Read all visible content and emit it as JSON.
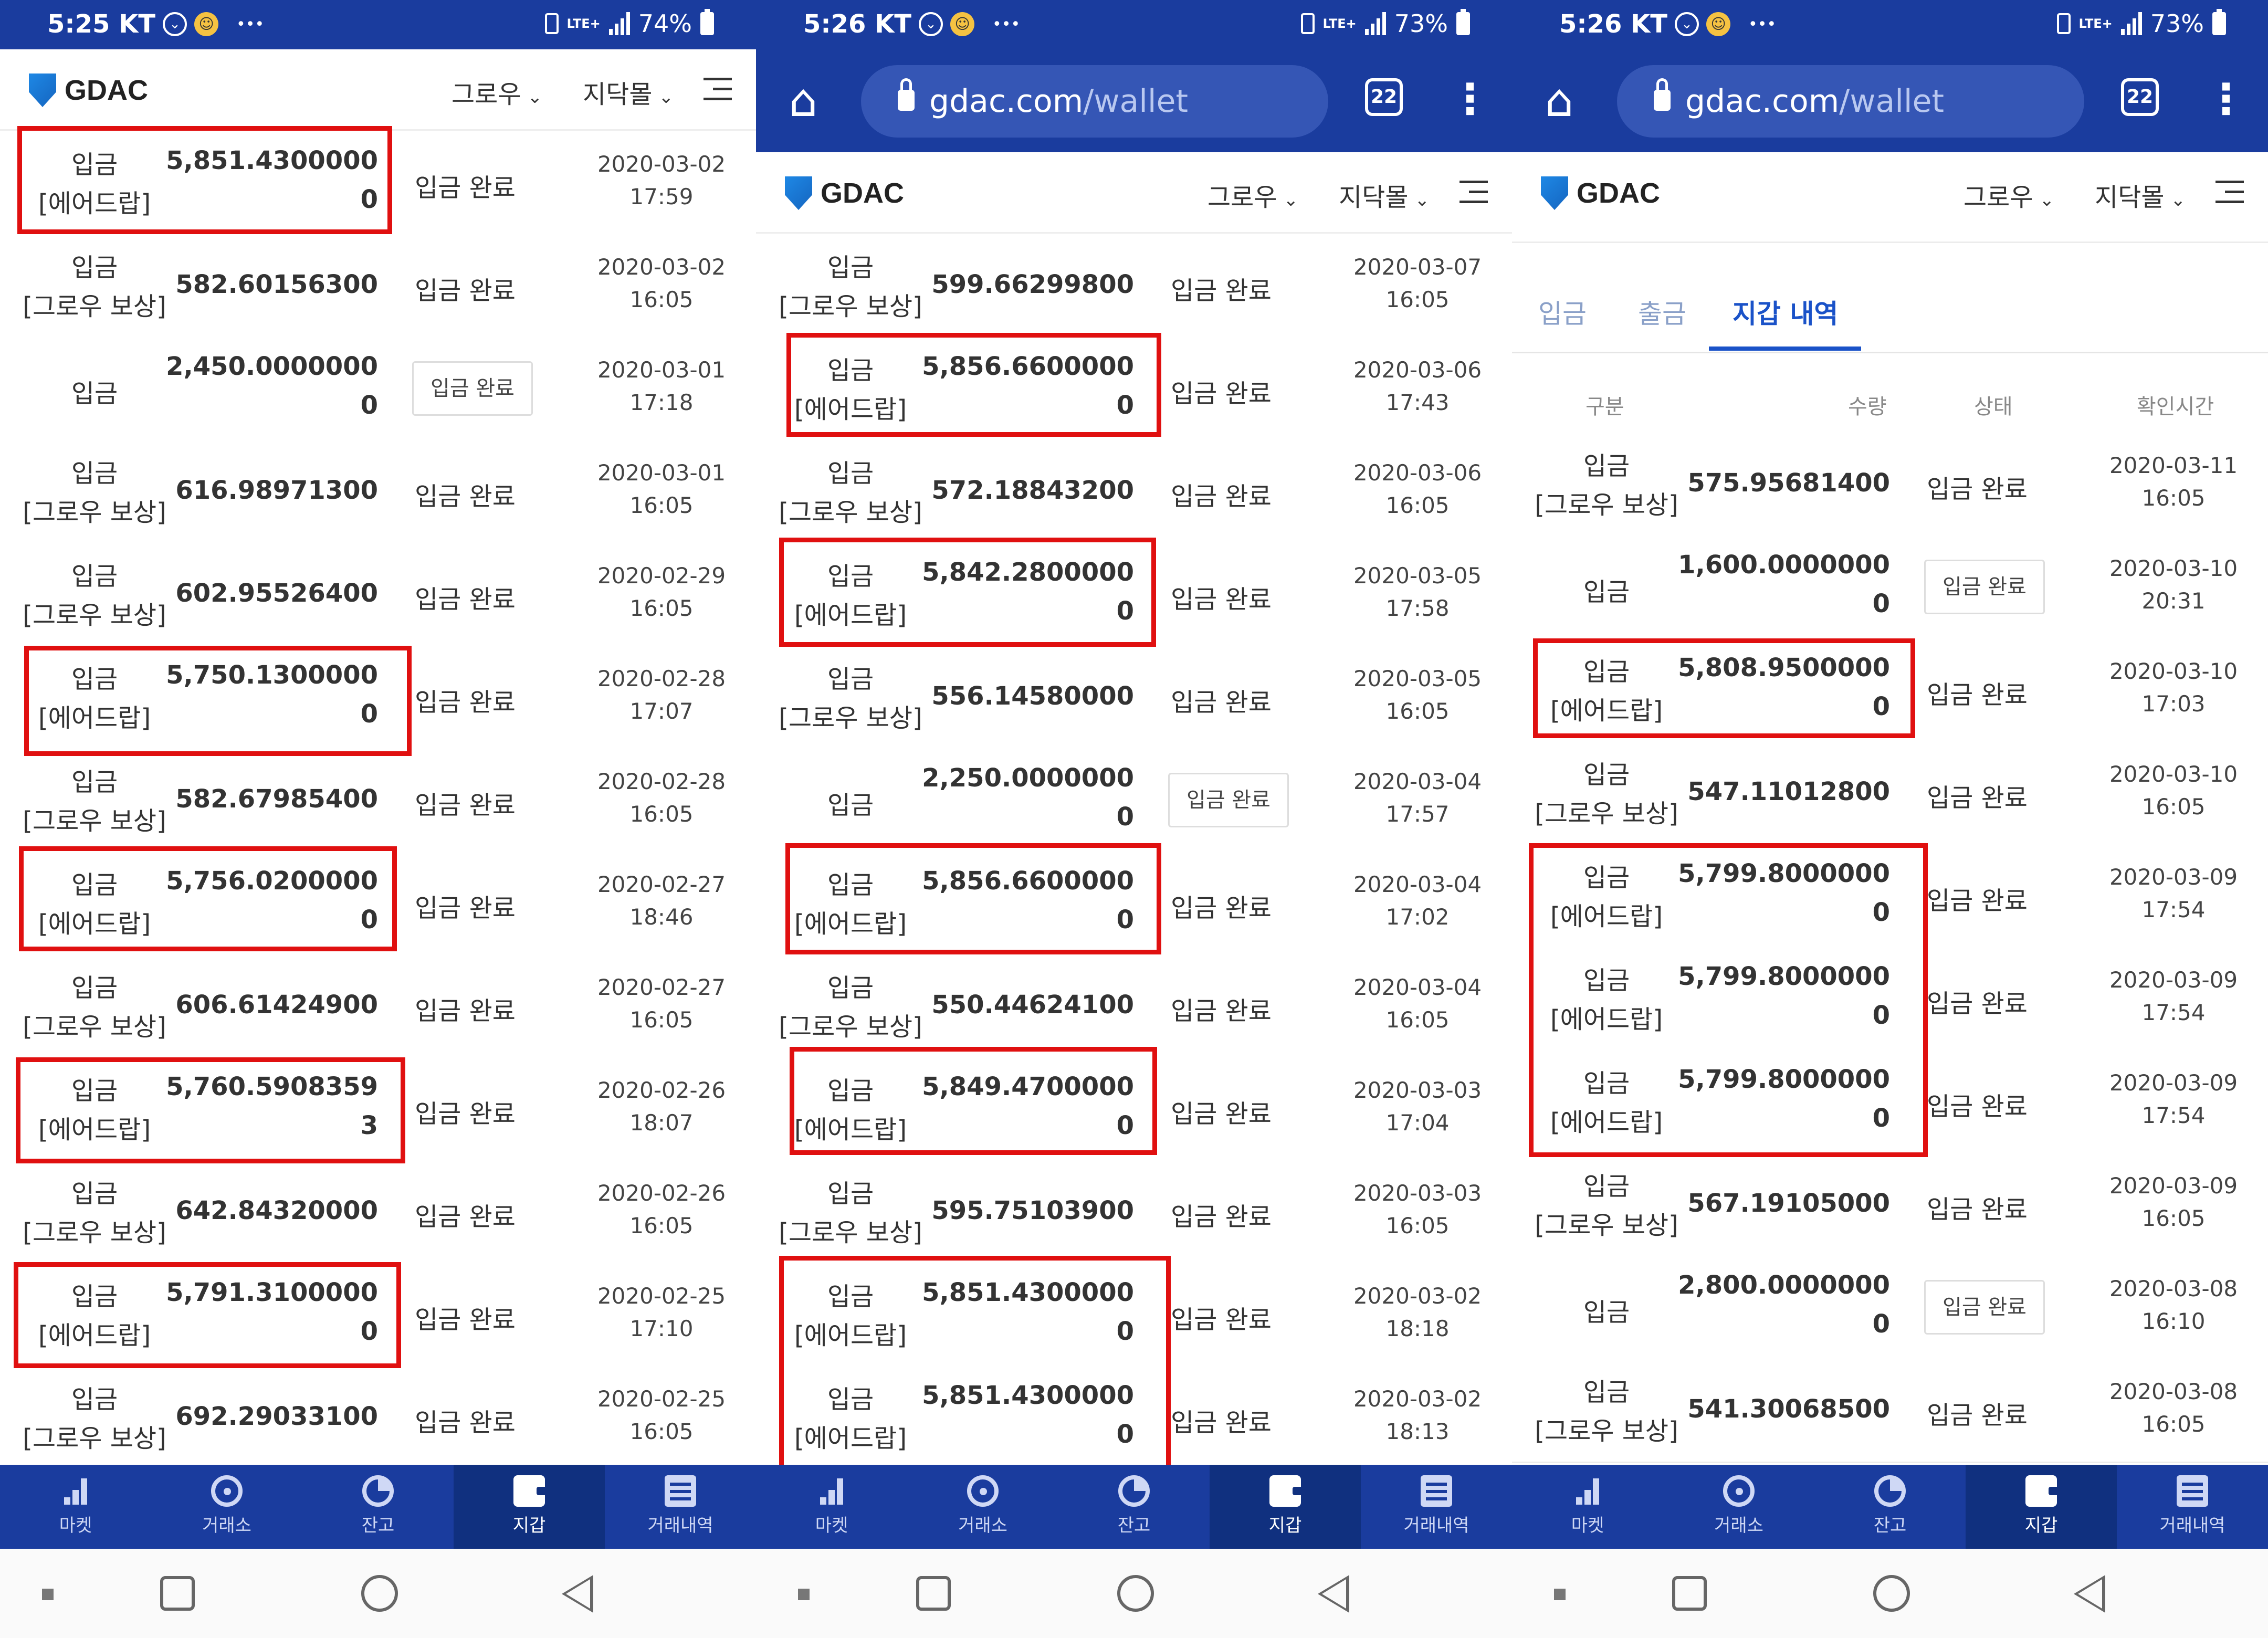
{
  "panels": [
    {
      "status": {
        "time": "5:25 KT",
        "battery": "74%",
        "network": "LTE+"
      },
      "header": {
        "logo": "GDAC",
        "menu1": "그로우",
        "menu2": "지닥몰"
      },
      "rows": [
        {
          "type1": "입금",
          "type2": "[에어드랍]",
          "amt1": "5,851.4300000",
          "amt2": "0",
          "state": "입금 완료",
          "date": "2020-03-02",
          "time": "17:59"
        },
        {
          "type1": "입금",
          "type2": "[그로우 보상]",
          "amt1": "582.60156300",
          "amt2": "",
          "state": "입금 완료",
          "date": "2020-03-02",
          "time": "16:05"
        },
        {
          "type1": "입금",
          "type2": "",
          "amt1": "2,450.0000000",
          "amt2": "0",
          "state": "입금 완료",
          "date": "2020-03-01",
          "time": "17:18"
        },
        {
          "type1": "입금",
          "type2": "[그로우 보상]",
          "amt1": "616.98971300",
          "amt2": "",
          "state": "입금 완료",
          "date": "2020-03-01",
          "time": "16:05"
        },
        {
          "type1": "입금",
          "type2": "[그로우 보상]",
          "amt1": "602.95526400",
          "amt2": "",
          "state": "입금 완료",
          "date": "2020-02-29",
          "time": "16:05"
        },
        {
          "type1": "입금",
          "type2": "[에어드랍]",
          "amt1": "5,750.1300000",
          "amt2": "0",
          "state": "입금 완료",
          "date": "2020-02-28",
          "time": "17:07"
        },
        {
          "type1": "입금",
          "type2": "[그로우 보상]",
          "amt1": "582.67985400",
          "amt2": "",
          "state": "입금 완료",
          "date": "2020-02-28",
          "time": "16:05"
        },
        {
          "type1": "입금",
          "type2": "[에어드랍]",
          "amt1": "5,756.0200000",
          "amt2": "0",
          "state": "입금 완료",
          "date": "2020-02-27",
          "time": "18:46"
        },
        {
          "type1": "입금",
          "type2": "[그로우 보상]",
          "amt1": "606.61424900",
          "amt2": "",
          "state": "입금 완료",
          "date": "2020-02-27",
          "time": "16:05"
        },
        {
          "type1": "입금",
          "type2": "[에어드랍]",
          "amt1": "5,760.5908359",
          "amt2": "3",
          "state": "입금 완료",
          "date": "2020-02-26",
          "time": "18:07"
        },
        {
          "type1": "입금",
          "type2": "[그로우 보상]",
          "amt1": "642.84320000",
          "amt2": "",
          "state": "입금 완료",
          "date": "2020-02-26",
          "time": "16:05"
        },
        {
          "type1": "입금",
          "type2": "[에어드랍]",
          "amt1": "5,791.3100000",
          "amt2": "0",
          "state": "입금 완료",
          "date": "2020-02-25",
          "time": "17:10"
        },
        {
          "type1": "입금",
          "type2": "[그로우 보상]",
          "amt1": "692.29033100",
          "amt2": "",
          "state": "입금 완료",
          "date": "2020-02-25",
          "time": "16:05"
        }
      ],
      "nav": [
        "마켓",
        "거래소",
        "잔고",
        "지갑",
        "거래내역"
      ]
    },
    {
      "status": {
        "time": "5:26 KT",
        "battery": "73%",
        "network": "LTE+"
      },
      "url": {
        "domain": "gdac.com",
        "path": "/wallet",
        "tabs": "22"
      },
      "header": {
        "logo": "GDAC",
        "menu1": "그로우",
        "menu2": "지닥몰"
      },
      "rows": [
        {
          "type1": "입금",
          "type2": "[그로우 보상]",
          "amt1": "599.66299800",
          "amt2": "",
          "state": "입금 완료",
          "date": "2020-03-07",
          "time": "16:05"
        },
        {
          "type1": "입금",
          "type2": "[에어드랍]",
          "amt1": "5,856.6600000",
          "amt2": "0",
          "state": "입금 완료",
          "date": "2020-03-06",
          "time": "17:43"
        },
        {
          "type1": "입금",
          "type2": "[그로우 보상]",
          "amt1": "572.18843200",
          "amt2": "",
          "state": "입금 완료",
          "date": "2020-03-06",
          "time": "16:05"
        },
        {
          "type1": "입금",
          "type2": "[에어드랍]",
          "amt1": "5,842.2800000",
          "amt2": "0",
          "state": "입금 완료",
          "date": "2020-03-05",
          "time": "17:58"
        },
        {
          "type1": "입금",
          "type2": "[그로우 보상]",
          "amt1": "556.14580000",
          "amt2": "",
          "state": "입금 완료",
          "date": "2020-03-05",
          "time": "16:05"
        },
        {
          "type1": "입금",
          "type2": "",
          "amt1": "2,250.0000000",
          "amt2": "0",
          "state": "입금 완료",
          "date": "2020-03-04",
          "time": "17:57"
        },
        {
          "type1": "입금",
          "type2": "[에어드랍]",
          "amt1": "5,856.6600000",
          "amt2": "0",
          "state": "입금 완료",
          "date": "2020-03-04",
          "time": "17:02"
        },
        {
          "type1": "입금",
          "type2": "[그로우 보상]",
          "amt1": "550.44624100",
          "amt2": "",
          "state": "입금 완료",
          "date": "2020-03-04",
          "time": "16:05"
        },
        {
          "type1": "입금",
          "type2": "[에어드랍]",
          "amt1": "5,849.4700000",
          "amt2": "0",
          "state": "입금 완료",
          "date": "2020-03-03",
          "time": "17:04"
        },
        {
          "type1": "입금",
          "type2": "[그로우 보상]",
          "amt1": "595.75103900",
          "amt2": "",
          "state": "입금 완료",
          "date": "2020-03-03",
          "time": "16:05"
        },
        {
          "type1": "입금",
          "type2": "[에어드랍]",
          "amt1": "5,851.4300000",
          "amt2": "0",
          "state": "입금 완료",
          "date": "2020-03-02",
          "time": "18:18"
        },
        {
          "type1": "입금",
          "type2": "[에어드랍]",
          "amt1": "5,851.4300000",
          "amt2": "0",
          "state": "입금 완료",
          "date": "2020-03-02",
          "time": "18:13"
        }
      ],
      "nav": [
        "마켓",
        "거래소",
        "잔고",
        "지갑",
        "거래내역"
      ]
    },
    {
      "status": {
        "time": "5:26 KT",
        "battery": "73%",
        "network": "LTE+"
      },
      "url": {
        "domain": "gdac.com",
        "path": "/wallet",
        "tabs": "22"
      },
      "header": {
        "logo": "GDAC",
        "menu1": "그로우",
        "menu2": "지닥몰"
      },
      "wallet_tabs": {
        "deposit": "입금",
        "withdraw": "출금",
        "history": "지갑 내역"
      },
      "columns": {
        "type": "구분",
        "amount": "수량",
        "state": "상태",
        "time": "확인시간"
      },
      "rows": [
        {
          "type1": "입금",
          "type2": "[그로우 보상]",
          "amt1": "575.95681400",
          "amt2": "",
          "state": "입금 완료",
          "date": "2020-03-11",
          "time": "16:05"
        },
        {
          "type1": "입금",
          "type2": "",
          "amt1": "1,600.0000000",
          "amt2": "0",
          "state": "입금 완료",
          "date": "2020-03-10",
          "time": "20:31"
        },
        {
          "type1": "입금",
          "type2": "[에어드랍]",
          "amt1": "5,808.9500000",
          "amt2": "0",
          "state": "입금 완료",
          "date": "2020-03-10",
          "time": "17:03"
        },
        {
          "type1": "입금",
          "type2": "[그로우 보상]",
          "amt1": "547.11012800",
          "amt2": "",
          "state": "입금 완료",
          "date": "2020-03-10",
          "time": "16:05"
        },
        {
          "type1": "입금",
          "type2": "[에어드랍]",
          "amt1": "5,799.8000000",
          "amt2": "0",
          "state": "입금 완료",
          "date": "2020-03-09",
          "time": "17:54"
        },
        {
          "type1": "입금",
          "type2": "[에어드랍]",
          "amt1": "5,799.8000000",
          "amt2": "0",
          "state": "입금 완료",
          "date": "2020-03-09",
          "time": "17:54"
        },
        {
          "type1": "입금",
          "type2": "[에어드랍]",
          "amt1": "5,799.8000000",
          "amt2": "0",
          "state": "입금 완료",
          "date": "2020-03-09",
          "time": "17:54"
        },
        {
          "type1": "입금",
          "type2": "[그로우 보상]",
          "amt1": "567.19105000",
          "amt2": "",
          "state": "입금 완료",
          "date": "2020-03-09",
          "time": "16:05"
        },
        {
          "type1": "입금",
          "type2": "",
          "amt1": "2,800.0000000",
          "amt2": "0",
          "state": "입금 완료",
          "date": "2020-03-08",
          "time": "16:10"
        },
        {
          "type1": "입금",
          "type2": "[그로우 보상]",
          "amt1": "541.30068500",
          "amt2": "",
          "state": "입금 완료",
          "date": "2020-03-08",
          "time": "16:05"
        }
      ],
      "nav": [
        "마켓",
        "거래소",
        "잔고",
        "지갑",
        "거래내역"
      ]
    }
  ],
  "colors": {
    "brand_blue": "#1a3c9e",
    "highlight_red": "#e01010",
    "tab_active": "#1a52c8"
  }
}
